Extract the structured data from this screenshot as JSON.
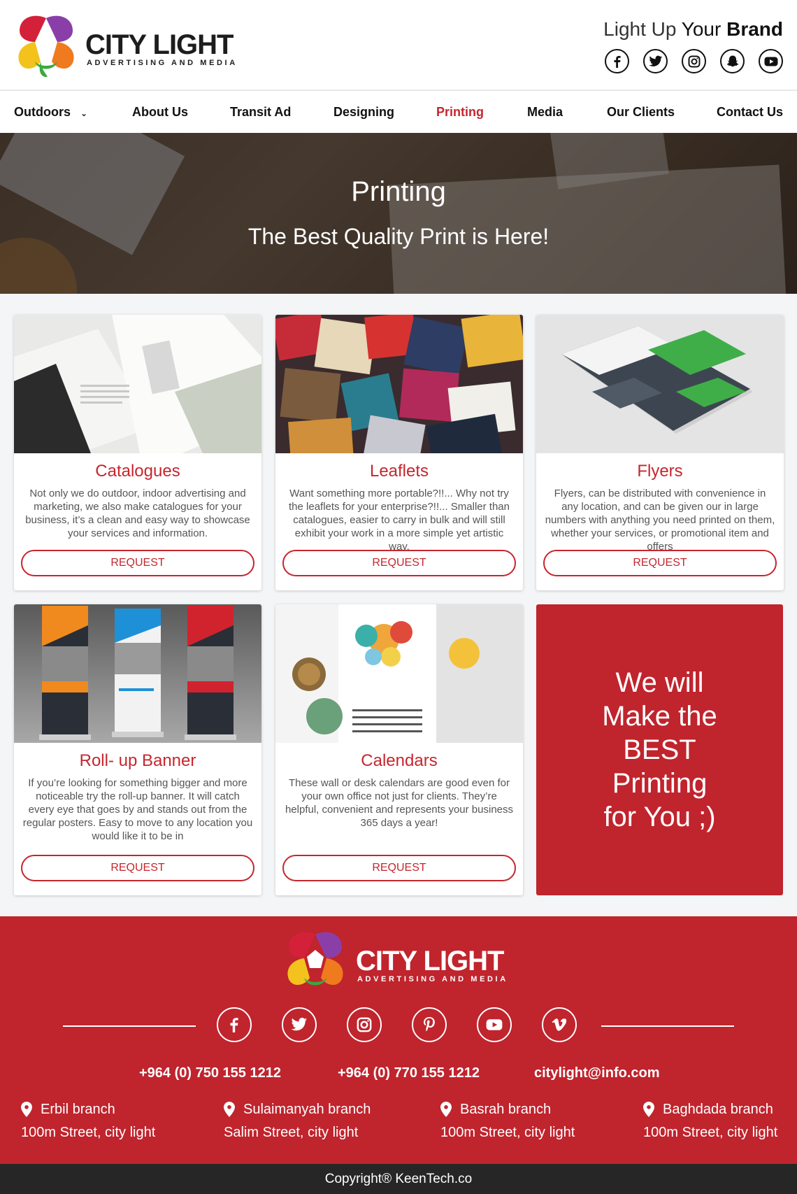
{
  "header": {
    "logo": {
      "name": "CITY LIGHT",
      "subtitle": "ADVERTISING AND MEDIA"
    },
    "tagline": {
      "part1": "Light Up",
      "part2": "Your",
      "part3": "Brand"
    },
    "social": [
      "facebook-icon",
      "twitter-icon",
      "instagram-icon",
      "snapchat-icon",
      "youtube-icon"
    ]
  },
  "nav": {
    "items": [
      {
        "label": "Outdoors"
      },
      {
        "label": "About Us"
      },
      {
        "label": "Transit Ad"
      },
      {
        "label": "Designing"
      },
      {
        "label": "Printing"
      },
      {
        "label": "Media"
      },
      {
        "label": "Our Clients"
      },
      {
        "label": "Contact Us"
      }
    ],
    "active": "Printing",
    "dropdown_indicator": "chevron-down-icon"
  },
  "hero": {
    "title": "Printing",
    "subtitle": "The Best Quality Print is Here!"
  },
  "cards": [
    {
      "title": "Catalogues",
      "desc": "Not only we do outdoor, indoor advertising and marketing, we also make catalogues for your business, it’s a clean and easy way to showcase your services and information.",
      "button": "REQUEST"
    },
    {
      "title": "Leaflets",
      "desc": "Want something more portable?!!... Why not try the leaflets for your enterprise?!!... Smaller than catalogues, easier to carry in bulk and will still exhibit your work in a more simple yet artistic way.",
      "button": "REQUEST"
    },
    {
      "title": "Flyers",
      "desc": "Flyers, can be distributed with convenience in any location, and can be given our in large numbers with anything you need printed on them, whether your services, or promotional item and offers",
      "button": "REQUEST"
    },
    {
      "title": "Roll- up Banner",
      "desc": "If you’re looking for something bigger and more noticeable try the roll-up banner. It will catch every eye that goes by and stands out from the regular posters. Easy to move to any location you would like it to be in",
      "button": "REQUEST"
    },
    {
      "title": "Calendars",
      "desc": "These wall or desk calendars are good even for your own office not just for clients. They’re helpful, convenient and represents your business 365 days a year!",
      "button": "REQUEST"
    }
  ],
  "promo": {
    "line1": "We will",
    "line2": "Make the",
    "line3": "BEST",
    "line4": "Printing",
    "line5": "for You ;)"
  },
  "footer": {
    "logo": {
      "name": "CITY LIGHT",
      "subtitle": "ADVERTISING AND MEDIA"
    },
    "social": [
      "facebook-icon",
      "twitter-icon",
      "instagram-icon",
      "pinterest-icon",
      "youtube-icon",
      "vimeo-icon"
    ],
    "phone1": "+964 (0) 750 155 1212",
    "phone2": "+964 (0) 770 155 1212",
    "email": "citylight@info.com",
    "branches": [
      {
        "name": "Erbil branch",
        "address": "100m Street, city light"
      },
      {
        "name": "Sulaimanyah branch",
        "address": "Salim Street, city light"
      },
      {
        "name": "Basrah branch",
        "address": "100m Street, city light"
      },
      {
        "name": "Baghdada branch",
        "address": "100m Street, city light"
      }
    ],
    "copyright": "Copyright® KeenTech.co"
  },
  "colors": {
    "brand_red": "#c0242d",
    "text_dark": "#111111",
    "footer_bar": "#262626"
  }
}
